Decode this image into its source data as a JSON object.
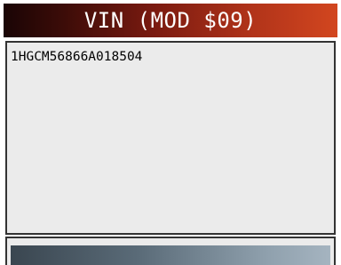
{
  "screen": {
    "title": "VIN (MOD $09)"
  },
  "content": {
    "vin": "1HGCM56866A018504"
  },
  "colors": {
    "title_bar_start": "#1a0505",
    "title_bar_end": "#d2461f",
    "panel_background": "#ebebeb",
    "panel_border": "#333333",
    "bottom_bar_start": "#3a4650",
    "bottom_bar_end": "#a5b4c0"
  }
}
